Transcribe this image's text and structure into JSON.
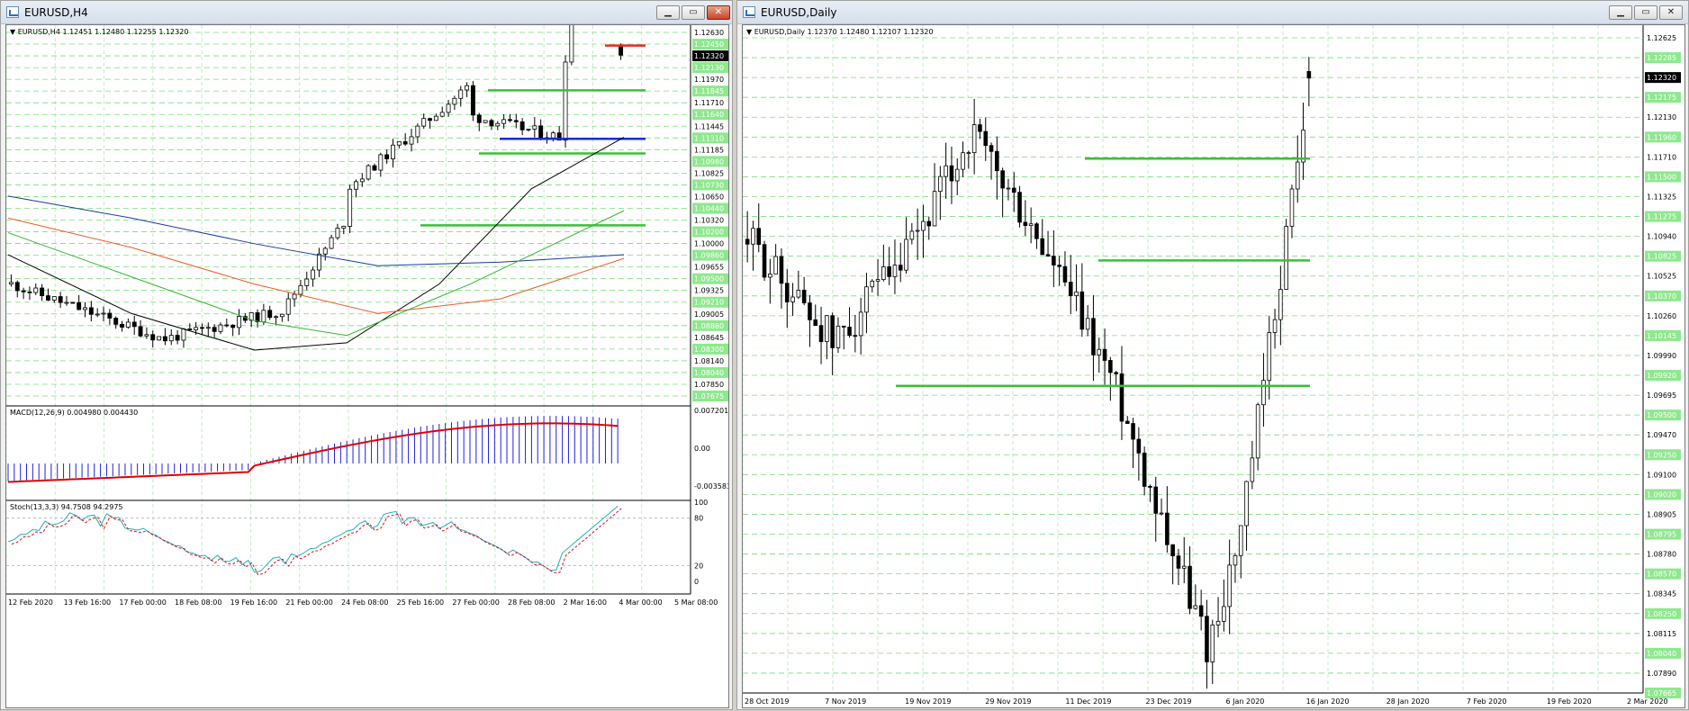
{
  "left": {
    "title": "EURUSD,H4",
    "info": "▼ EURUSD,H4  1.12451 1.12480 1.12255 1.12320",
    "price_labels": [
      "1.12630",
      "1.12450",
      "1.12320",
      "1.12130",
      "1.11970",
      "1.11845",
      "1.11710",
      "1.11640",
      "1.11445",
      "1.11310",
      "1.11185",
      "1.10980",
      "1.10825",
      "1.10730",
      "1.10650",
      "1.10440",
      "1.10320",
      "1.10200",
      "1.10000",
      "1.09860",
      "1.09655",
      "1.09500",
      "1.09325",
      "1.09210",
      "1.09005",
      "1.08880",
      "1.08645",
      "1.08300",
      "1.08140",
      "1.08040",
      "1.07850",
      "1.07675"
    ],
    "current_price": "1.12320",
    "macd_label": "MACD(12,26,9) 0.004980 0.004430",
    "macd_scale": [
      "0.007201",
      "0.00",
      "-0.003583"
    ],
    "stoch_label": "Stoch(13,3,3) 94.7508 94.2975",
    "stoch_scale": [
      "100",
      "80",
      "20",
      "0"
    ],
    "time_labels": [
      "12 Feb 2020",
      "13 Feb 16:00",
      "17 Feb 00:00",
      "18 Feb 08:00",
      "19 Feb 16:00",
      "21 Feb 00:00",
      "24 Feb 08:00",
      "25 Feb 16:00",
      "27 Feb 00:00",
      "28 Feb 08:00",
      "2 Mar 16:00",
      "4 Mar 00:00",
      "5 Mar 08:00"
    ]
  },
  "right": {
    "title": "EURUSD,Daily",
    "info": "▼ EURUSD,Daily  1.12370 1.12480 1.12107 1.12320",
    "price_labels": [
      "1.12625",
      "1.12285",
      "1.12320",
      "1.12175",
      "1.12130",
      "1.11960",
      "1.11710",
      "1.11500",
      "1.11325",
      "1.11275",
      "1.10940",
      "1.10825",
      "1.10525",
      "1.10370",
      "1.10260",
      "1.10145",
      "1.09990",
      "1.09920",
      "1.09695",
      "1.09500",
      "1.09470",
      "1.09250",
      "1.09100",
      "1.09020",
      "1.08905",
      "1.08795",
      "1.08780",
      "1.08570",
      "1.08345",
      "1.08250",
      "1.08115",
      "1.08040",
      "1.07890",
      "1.07665"
    ],
    "current_price": "1.12320",
    "time_labels": [
      "28 Oct 2019",
      "7 Nov 2019",
      "19 Nov 2019",
      "29 Nov 2019",
      "11 Dec 2019",
      "23 Dec 2019",
      "6 Jan 2020",
      "16 Jan 2020",
      "28 Jan 2020",
      "7 Feb 2020",
      "19 Feb 2020",
      "2 Mar 2020"
    ]
  },
  "colors": {
    "grid": "#c8e8c8",
    "level_line": "#7ddc7d",
    "green_line": "#38c038",
    "blue_line": "#1a2ad8",
    "red_line": "#e8281e",
    "ma_black": "#000000",
    "ma_blue": "#1a3aa0",
    "ma_red": "#f05a28",
    "ma_green": "#30b830",
    "macd_hist": "#2020e0",
    "macd_signal": "#e00000",
    "stoch_main": "#20b0c0",
    "stoch_signal": "#e01010"
  }
}
